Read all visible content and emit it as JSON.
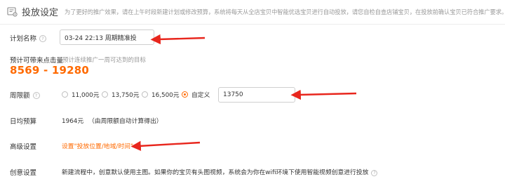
{
  "header": {
    "title": "投放设定",
    "description": "为了更好的推广效果，请在上午时段新建计划或修改预算，系统将每天从全店宝贝中智能优选宝贝进行自动投放，请您自检自查店铺宝贝，在投放前确认宝贝已符合推广要求。"
  },
  "plan_name": {
    "label": "计划名称",
    "help": "?",
    "value": "03-24 22:13 周期精准投"
  },
  "estimate": {
    "label": "预计可带来点击量",
    "hint": "预计连续推广一周可达到的目标",
    "range": "8569 - 19280"
  },
  "weekly_budget": {
    "label": "周限额",
    "help": "?",
    "options": [
      "11,000元",
      "13,750元",
      "16,500元",
      "自定义"
    ],
    "selected": "自定义",
    "custom_value": "13750"
  },
  "daily_budget": {
    "label": "日均预算",
    "value": "1964元",
    "note": "（由周限额自动计算得出）"
  },
  "advanced": {
    "label": "高级设置",
    "link": "设置\"投放位置/地域/时间\""
  },
  "creative": {
    "label": "创意设置",
    "text": "新建流程中，创意默认使用主图。如果你的宝贝有头图视频，系统会为你在wifi环境下使用智能视频创意进行投放",
    "help": "?"
  },
  "colors": {
    "accent": "#ff6a00",
    "annotation_arrow": "#e8261d"
  },
  "icons": {
    "header": "settings-panel-icon"
  }
}
